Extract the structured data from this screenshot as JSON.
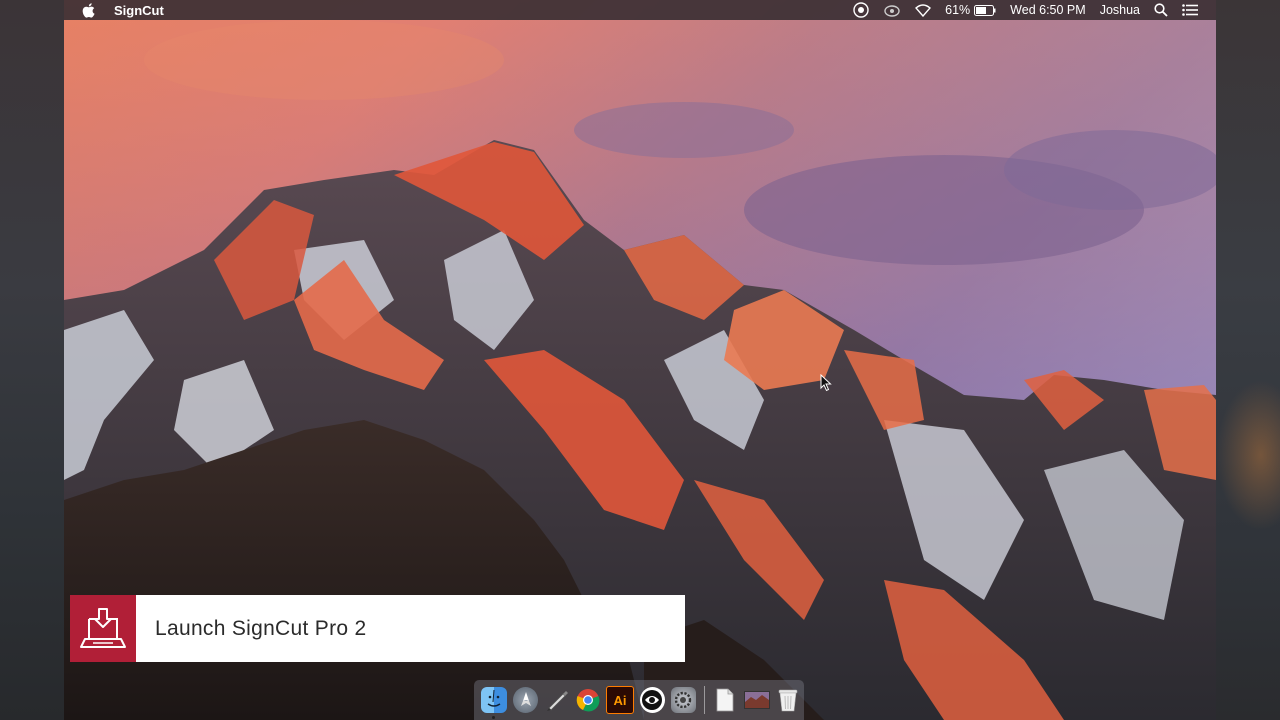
{
  "menubar": {
    "app_name": "SignCut",
    "battery_percent": "61%",
    "clock": "Wed 6:50 PM",
    "user_name": "Joshua"
  },
  "lower_third": {
    "caption": "Launch SignCut Pro 2"
  },
  "dock": {
    "items": [
      {
        "name": "finder-icon"
      },
      {
        "name": "launchpad-icon"
      },
      {
        "name": "pen-tool-icon"
      },
      {
        "name": "chrome-icon"
      },
      {
        "name": "illustrator-icon",
        "label": "Ai"
      },
      {
        "name": "signcut-icon"
      },
      {
        "name": "system-preferences-icon"
      },
      {
        "name": "document-icon"
      },
      {
        "name": "screen-thumbnail-icon"
      },
      {
        "name": "trash-icon"
      }
    ]
  },
  "colors": {
    "accent_red": "#b11f37",
    "menubar_bg": "#3c3034"
  }
}
